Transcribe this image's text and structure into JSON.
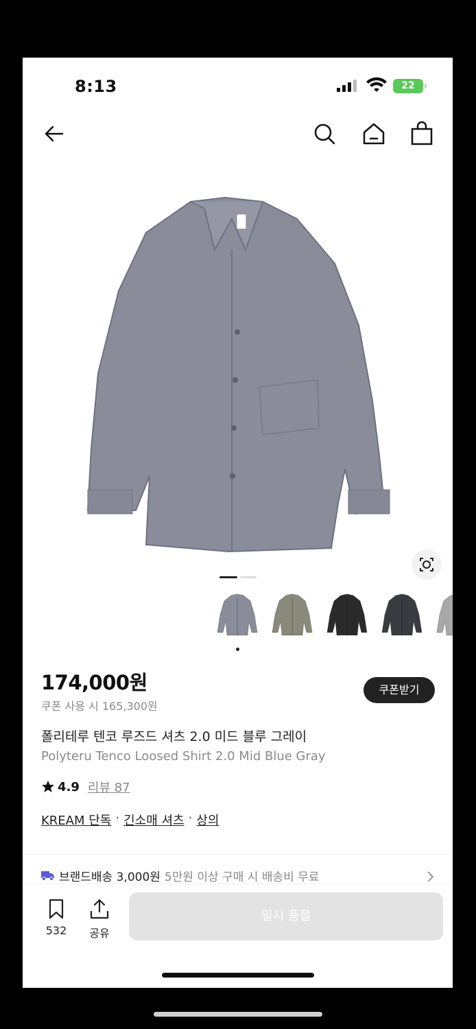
{
  "status_bar": {
    "time": "8:13",
    "battery": "22"
  },
  "nav": {
    "back_icon": "arrow-left-icon",
    "search_icon": "search-icon",
    "home_icon": "home-icon",
    "cart_icon": "shopping-bag-icon"
  },
  "product": {
    "image_colors": [
      "#8a8d99",
      "#8a8a7c",
      "#2a2a2a",
      "#3a3b40",
      "#a8a8a8"
    ],
    "price": "174,000원",
    "coupon_price": "쿠폰 사용 시 165,300원",
    "coupon_button": "쿠폰받기",
    "name_ko": "폴리테루 텐코 루즈드 셔츠 2.0 미드 블루 그레이",
    "name_en": "Polyteru Tenco Loosed Shirt 2.0 Mid Blue Gray",
    "rating": "4.9",
    "review": "리뷰 87",
    "tags": [
      "KREAM 단독",
      "긴소매 셔츠",
      "상의"
    ],
    "tag_separator": "·"
  },
  "shipping": {
    "label": "브랜드배송 3,000원",
    "note": "5만원 이상 구매 시 배송비 무료"
  },
  "bottom": {
    "save_count": "532",
    "share_label": "공유",
    "buy_label": "일시 품절"
  },
  "colors": {
    "accent": "#222222",
    "disabled": "#e3e3e3",
    "battery": "#5bc95a",
    "truck": "#5b5bd6"
  }
}
